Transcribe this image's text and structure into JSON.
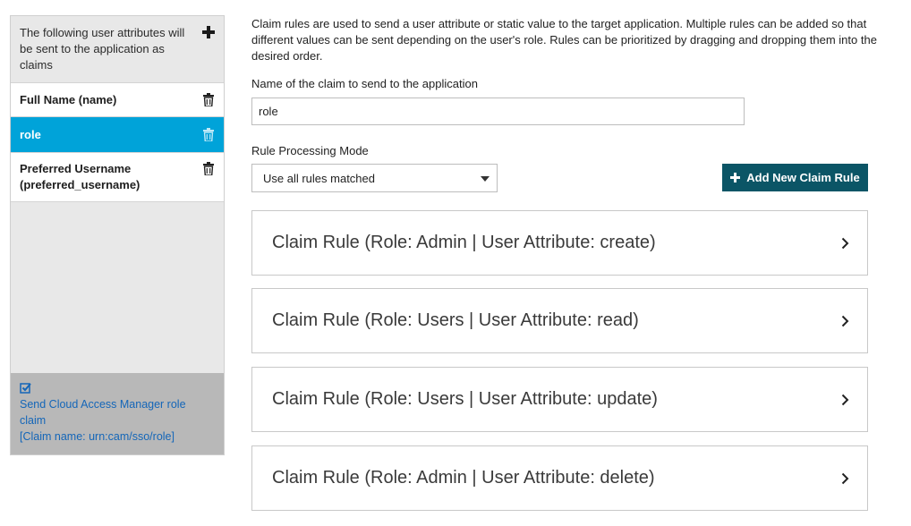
{
  "sidebar": {
    "header": "The following user attributes will be sent to the application as claims",
    "add_icon": "plus-icon",
    "items": [
      {
        "label": "Full Name (name)",
        "selected": false
      },
      {
        "label": "role",
        "selected": true
      },
      {
        "label": "Preferred Username (preferred_username)",
        "selected": false
      }
    ],
    "footer": {
      "checkbox_icon": "checked-checkbox-icon",
      "link_text": "Send Cloud Access Manager role claim",
      "claim_name": "[Claim name: urn:cam/sso/role]"
    }
  },
  "main": {
    "intro": "Claim rules are used to send a user attribute or static value to the target application. Multiple rules can be added so that different values can be sent depending on the user's role. Rules can be prioritized by dragging and dropping them into the desired order.",
    "claim_name_label": "Name of the claim to send to the application",
    "claim_name_value": "role",
    "mode_label": "Rule Processing Mode",
    "mode_value": "Use all rules matched",
    "add_rule_label": "Add New Claim Rule",
    "rules": [
      "Claim Rule (Role: Admin | User Attribute: create)",
      "Claim Rule (Role: Users | User Attribute: read)",
      "Claim Rule (Role: Users | User Attribute: update)",
      "Claim Rule (Role: Admin | User Attribute: delete)"
    ]
  },
  "colors": {
    "selected_item": "#00a3d9",
    "primary_button": "#0b5566",
    "link": "#1466b8",
    "sidebar_bg": "#e8e8e8",
    "footer_bg": "#b8b8b8"
  }
}
